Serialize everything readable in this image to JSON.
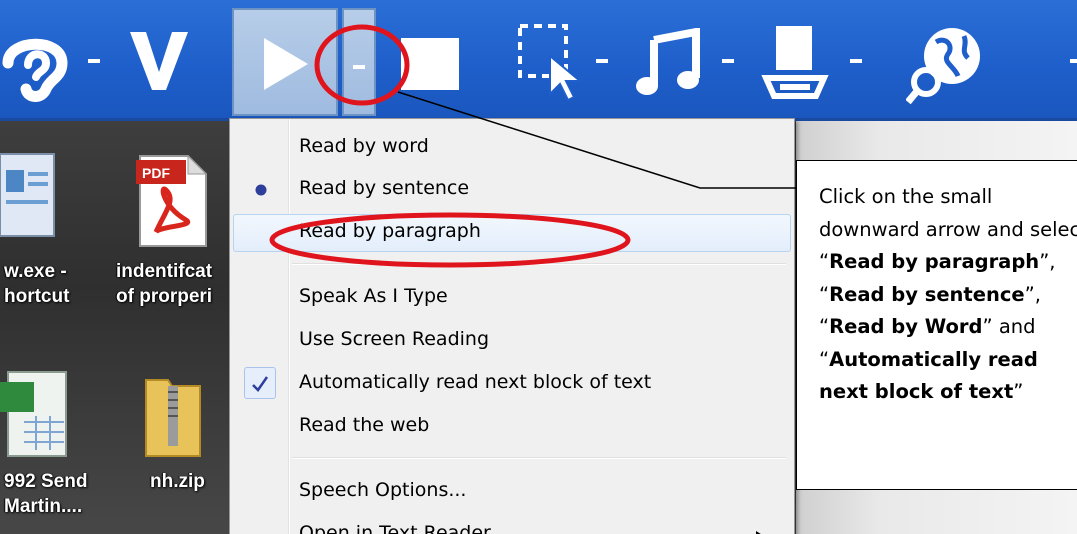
{
  "toolbar": {
    "buttons": [
      {
        "name": "listen-icon"
      },
      {
        "name": "verify-icon"
      },
      {
        "name": "play-icon"
      },
      {
        "name": "stop-icon"
      },
      {
        "name": "select-region-icon"
      },
      {
        "name": "music-note-icon"
      },
      {
        "name": "scanner-icon"
      },
      {
        "name": "web-search-icon"
      }
    ]
  },
  "desktop": {
    "icons": [
      {
        "label_line1": "w.exe -",
        "label_line2": "hortcut"
      },
      {
        "label_line1": "indentifcat",
        "label_line2": "of prorperi",
        "badge": "PDF"
      },
      {
        "label_line1": "992 Send",
        "label_line2": "Martin...."
      },
      {
        "label_line1": "nh.zip",
        "label_line2": ""
      }
    ]
  },
  "menu": {
    "items": [
      {
        "label": "Read by word"
      },
      {
        "label": "Read by sentence",
        "mark": "radio"
      },
      {
        "label": "Read by paragraph",
        "hover": true
      },
      {
        "label": "Speak As I Type"
      },
      {
        "label": "Use Screen Reading"
      },
      {
        "label": "Automatically read next block of text",
        "mark": "check"
      },
      {
        "label": "Read the web"
      },
      {
        "label": "Speech Options..."
      },
      {
        "label": "Open in Text Reader",
        "submenu": true
      }
    ]
  },
  "callout": {
    "t1": "Click on the small downward arrow and select “",
    "b1": "Read by paragraph",
    "t2": "”, “",
    "b2": "Read by sentence",
    "t3": "”, “",
    "b3": "Read by Word",
    "t4": "” and “",
    "b4": "Automatically read next block of text",
    "t5": "”"
  },
  "colors": {
    "toolbar": "#1f5fcb",
    "annotation": "#e0141c",
    "menu": "#f0f0f0"
  }
}
